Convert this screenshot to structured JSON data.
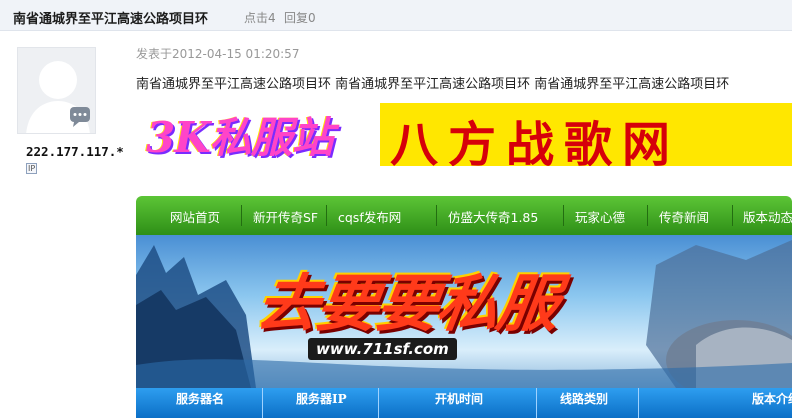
{
  "thread": {
    "title": "南省通城界至平江高速公路项目环",
    "clicks": "点击4",
    "replies": "回复0"
  },
  "author": {
    "name": "222.177.117.*",
    "badge": "IP"
  },
  "post": {
    "time": "发表于2012-04-15 01:20:57",
    "content": "南省通城界至平江高速公路项目环 南省通城界至平江高速公路项目环 南省通城界至平江高速公路项目环"
  },
  "ad_banner": {
    "left_text": "3K私服站",
    "right_text": "八方战歌网"
  },
  "site_nav": {
    "items": [
      "网站首页",
      "新开传奇SF",
      "cqsf发布网",
      "仿盛大传奇1.85",
      "玩家心德",
      "传奇新闻",
      "版本动态"
    ]
  },
  "hero": {
    "title": "去要要私服",
    "url": "www.711sf.com"
  },
  "server_table": {
    "headers": [
      "服务器名",
      "服务器IP",
      "开机时间",
      "线路类别",
      "版本介绍"
    ]
  },
  "colors": {
    "nav_green": "#3ea823",
    "table_blue": "#0b6fc6",
    "banner_yellow": "#ffe700"
  }
}
